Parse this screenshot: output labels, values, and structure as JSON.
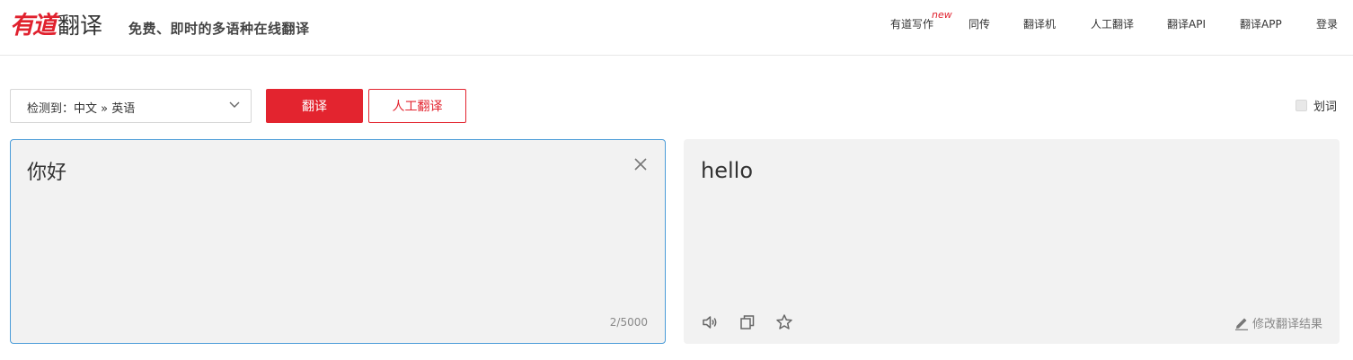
{
  "header": {
    "logo_brand": "有道",
    "logo_product": "翻译",
    "slogan": "免费、即时的多语种在线翻译",
    "nav": [
      {
        "label": "有道写作",
        "icon": "new-badge"
      },
      {
        "label": "同传"
      },
      {
        "label": "翻译机"
      },
      {
        "label": "人工翻译"
      },
      {
        "label": "翻译API"
      },
      {
        "label": "翻译APP"
      },
      {
        "label": "登录"
      }
    ],
    "new_badge": "new"
  },
  "toolbar": {
    "language_select": "检测到：中文  »  英语",
    "translate_button": "翻译",
    "human_translate_button": "人工翻译",
    "word_pick_label": "划词",
    "word_pick_checked": false
  },
  "input": {
    "text": "你好",
    "char_count": "2/5000"
  },
  "output": {
    "text": "hello",
    "edit_label": "修改翻译结果"
  },
  "colors": {
    "brand_red": "#e3242f",
    "input_border": "#4b9cd8",
    "panel_bg": "#f2f2f2"
  },
  "icons": [
    "clear-icon",
    "speaker-icon",
    "copy-icon",
    "star-icon",
    "pencil-icon",
    "chevron-down-icon"
  ]
}
